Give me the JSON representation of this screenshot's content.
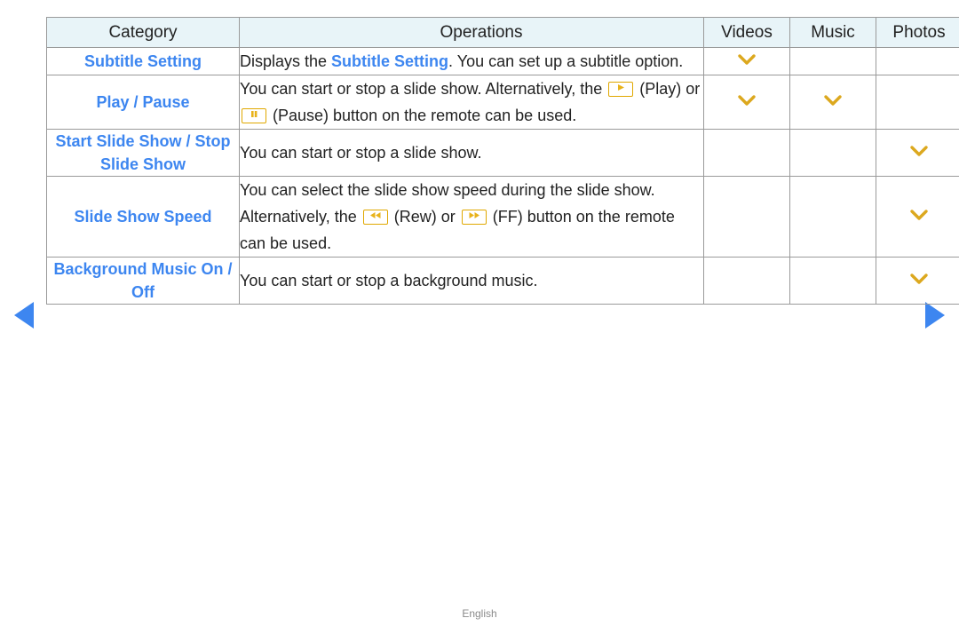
{
  "nav": {
    "prev_label": "previous-page",
    "next_label": "next-page"
  },
  "table": {
    "headers": {
      "category": "Category",
      "operations": "Operations",
      "videos": "Videos",
      "music": "Music",
      "photos": "Photos"
    },
    "rows": [
      {
        "category": "Subtitle Setting",
        "ops_pre": "Displays the ",
        "ops_kw": "Subtitle Setting",
        "ops_post": ".  You can set up a subtitle option.",
        "videos": true,
        "music": false,
        "photos": false
      },
      {
        "category": "Play / Pause",
        "ops_pre": "You can start or stop a slide show. Alternatively, the ",
        "ops_icon1": "play-icon",
        "ops_mid1": " (Play) or ",
        "ops_icon2": "pause-icon",
        "ops_post": " (Pause) button on the remote can be used.",
        "videos": true,
        "music": true,
        "photos": false
      },
      {
        "category": "Start Slide Show / Stop Slide Show",
        "ops_pre": "You can start or stop a slide show.",
        "videos": false,
        "music": false,
        "photos": true
      },
      {
        "category": "Slide Show Speed",
        "ops_pre": "You can select the slide show speed during the slide show. Alternatively, the ",
        "ops_icon1": "rewind-icon",
        "ops_mid1": " (Rew) or ",
        "ops_icon2": "fast-forward-icon",
        "ops_post": " (FF) button on the remote can be used.",
        "videos": false,
        "music": false,
        "photos": true
      },
      {
        "category": "Background Music On / Off",
        "ops_pre": "You can start or stop a background music.",
        "videos": false,
        "music": false,
        "photos": true
      }
    ]
  },
  "footer": {
    "language": "English"
  },
  "colors": {
    "accent_blue": "#3d86f0",
    "header_bg": "#e8f4f8",
    "gold": "#e0a800",
    "chevron_gold": "#dca81e",
    "border": "#9a9a9a"
  }
}
